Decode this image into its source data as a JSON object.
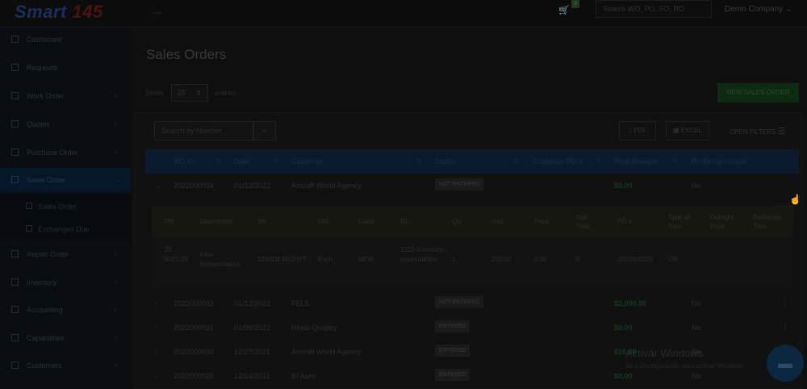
{
  "app": {
    "logo_text": "Smart ",
    "logo_num": "145",
    "company": "Demo Company",
    "top_search_placeholder": "Search WO, PO, SO, RO",
    "cart_count": "0"
  },
  "sidebar": {
    "items": [
      {
        "label": "Dashboard",
        "chev": ""
      },
      {
        "label": "Requests",
        "chev": ""
      },
      {
        "label": "Work Order",
        "chev": "‹"
      },
      {
        "label": "Quotes",
        "chev": "‹"
      },
      {
        "label": "Purchase Order",
        "chev": "‹"
      },
      {
        "label": "Sales Order",
        "chev": "⌄"
      },
      {
        "label": "Repair Order",
        "chev": "‹"
      },
      {
        "label": "Inventory",
        "chev": "‹"
      },
      {
        "label": "Accounting",
        "chev": "‹"
      },
      {
        "label": "Capabilities",
        "chev": "‹"
      },
      {
        "label": "Customers",
        "chev": "‹"
      }
    ],
    "sub_items": [
      {
        "label": "Sales Order"
      },
      {
        "label": "Exchanges Due"
      }
    ]
  },
  "page": {
    "title": "Sales Orders",
    "show_label": "Show",
    "show_value": "25",
    "entries_label": "entries",
    "new_button": "NEW SALES ORDER",
    "search_placeholder": "Search by Number",
    "pdf_label": "PDF",
    "excel_label": "EXCEL",
    "filters_label": "OPEN FILTERS"
  },
  "table": {
    "headers": [
      "SO #",
      "Date",
      "Customer",
      "Status",
      "Customer PO #",
      "Total Amount",
      "Proforma Invoice"
    ],
    "rows": [
      {
        "so": "2022000034",
        "date": "01/13/2022",
        "customer": "Aircraft World Agency",
        "status": "NOT ENTERED",
        "amount": "$0.00",
        "proforma": "No",
        "expanded": "⌄"
      },
      {
        "so": "2022000033",
        "date": "01/12/2022",
        "customer": "FELS",
        "status": "NOT ENTERED",
        "amount": "$2,000.00",
        "proforma": "No",
        "expanded": "›"
      },
      {
        "so": "2022000031",
        "date": "01/06/2022",
        "customer": "Hinds-Quigley",
        "status": "ENTERED",
        "amount": "$0.00",
        "proforma": "No",
        "expanded": "›"
      },
      {
        "so": "2022000030",
        "date": "12/27/2021",
        "customer": "Aircraft World Agency",
        "status": "ENTERED",
        "amount": "$10.00",
        "proforma": "No",
        "expanded": "›"
      },
      {
        "so": "2022000029",
        "date": "12/14/2021",
        "customer": "BI Aero",
        "status": "ENTERED",
        "amount": "$0.00",
        "proforma": "No",
        "expanded": "›"
      }
    ]
  },
  "detail": {
    "headers": [
      "PN",
      "Description",
      "SN",
      "UM",
      "Cond",
      "GL",
      "Qty",
      "cost",
      "Price",
      "Sub Total",
      "PO #",
      "Type of Sale",
      "Outright Price",
      "Exchange Time"
    ],
    "row": {
      "pn": "25 0021-29",
      "description": "Filter Nomenclature",
      "sn": "123XDE45CHYT",
      "um": "Each",
      "cond": "NEW",
      "gl": "1210 Inventory - expendables",
      "qty": "1",
      "cost": "250.00",
      "price": "0.00",
      "subtotal": "0",
      "po": "2020000028",
      "type": "OR",
      "outright": "",
      "exchange": ""
    }
  },
  "os": {
    "activate_title": "Activar Windows",
    "activate_sub": "Ve a Configuración para activar Windows."
  }
}
